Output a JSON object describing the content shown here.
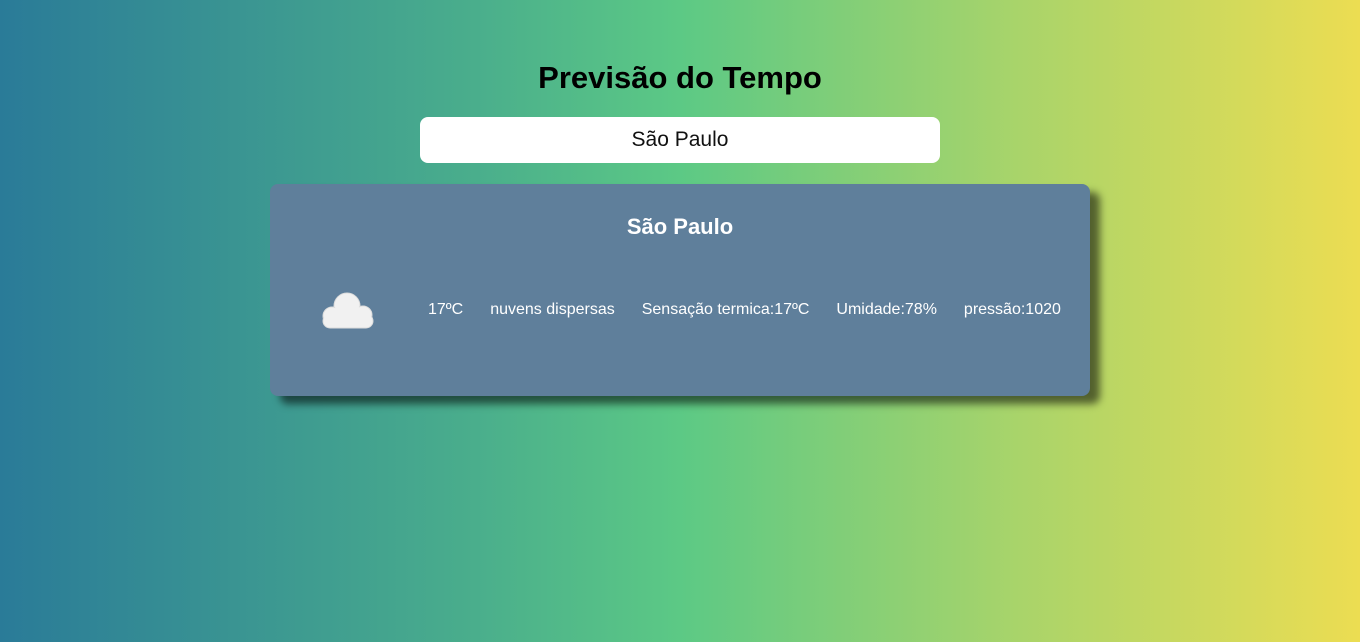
{
  "header": {
    "title": "Previsão do Tempo"
  },
  "search": {
    "value": "São Paulo"
  },
  "weather": {
    "city": "São Paulo",
    "icon": "cloud-icon",
    "temperature": "17ºC",
    "description": "nuvens dispersas",
    "feels_like": "Sensação termica:17ºC",
    "humidity": "Umidade:78%",
    "pressure": "pressão:1020"
  },
  "colors": {
    "gradient_start": "#2a7b98",
    "gradient_mid": "#5cc985",
    "gradient_end": "#ecdd52",
    "card_bg": "#5f7f9b"
  }
}
